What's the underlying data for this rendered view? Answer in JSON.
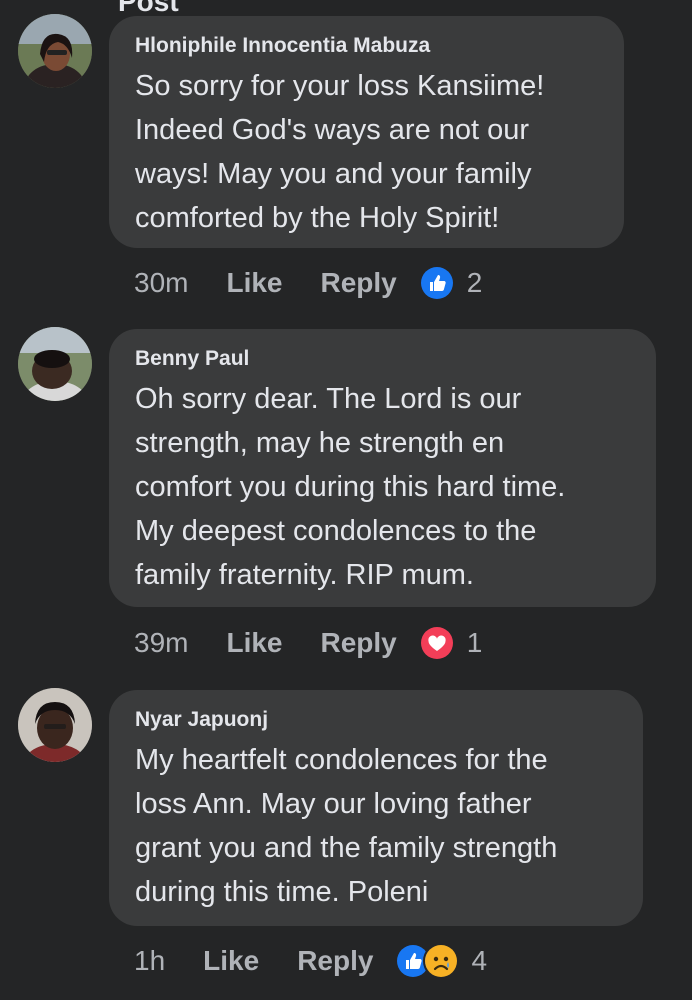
{
  "header": {
    "partial_title": "Post"
  },
  "comments": [
    {
      "author": "Hloniphile Innocentia Mabuza",
      "text": "So sorry for your loss Kansiime!\nIndeed God's ways are not our\nways! May you and your family\ncomforted by the Holy Spirit!",
      "time": "30m",
      "like_label": "Like",
      "reply_label": "Reply",
      "reactions": [
        "like-icon"
      ],
      "reaction_count": "2"
    },
    {
      "author": "Benny Paul",
      "text": "Oh sorry dear. The Lord is our\nstrength, may he strength en\ncomfort you during this hard time.\nMy deepest condolences to the\nfamily fraternity. RIP mum.",
      "time": "39m",
      "like_label": "Like",
      "reply_label": "Reply",
      "reactions": [
        "love-icon"
      ],
      "reaction_count": "1"
    },
    {
      "author": "Nyar Japuonj",
      "text": "My heartfelt condolences for the\nloss Ann. May our loving father\ngrant you and the family strength\nduring this time. Poleni",
      "time": "1h",
      "like_label": "Like",
      "reply_label": "Reply",
      "reactions": [
        "like-icon",
        "sad-icon"
      ],
      "reaction_count": "4"
    }
  ],
  "colors": {
    "background": "#242526",
    "bubble": "#3a3b3c",
    "text": "#e4e6eb",
    "secondary_text": "#b0b3b8",
    "like_blue": "#1877f2",
    "love_red": "#f33e58",
    "sad_yellow": "#f7b125"
  }
}
